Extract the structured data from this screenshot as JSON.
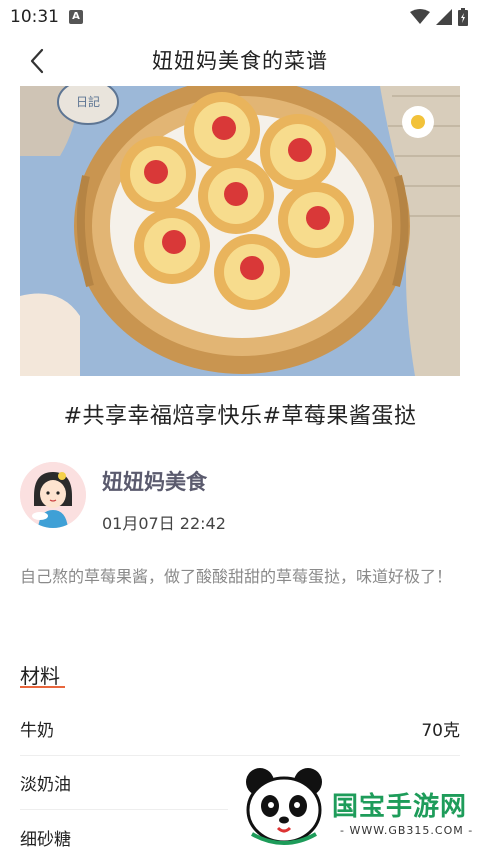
{
  "status_bar": {
    "time": "10:31",
    "notification_letter": "A"
  },
  "header": {
    "title": "妞妞妈美食的菜谱"
  },
  "recipe": {
    "title": "#共享幸福焙享快乐#草莓果酱蛋挞",
    "description": "自己熬的草莓果酱，做了酸酸甜甜的草莓蛋挞，味道好极了！"
  },
  "author": {
    "name": "妞妞妈美食",
    "date": "01月07日 22:42"
  },
  "ingredients_section": {
    "title": "材料"
  },
  "ingredients": [
    {
      "name": "牛奶",
      "amount": "70克"
    },
    {
      "name": "淡奶油",
      "amount": ""
    },
    {
      "name": "细砂糖",
      "amount": ""
    }
  ],
  "hero_image": {
    "plate_stamp": "日記"
  },
  "watermark": {
    "brand": "国宝手游网",
    "url": "- WWW.GB315.COM -"
  },
  "colors": {
    "accent": "#e8663d",
    "author_name": "#5b5b6e",
    "watermark_green": "#1e9c5a"
  }
}
